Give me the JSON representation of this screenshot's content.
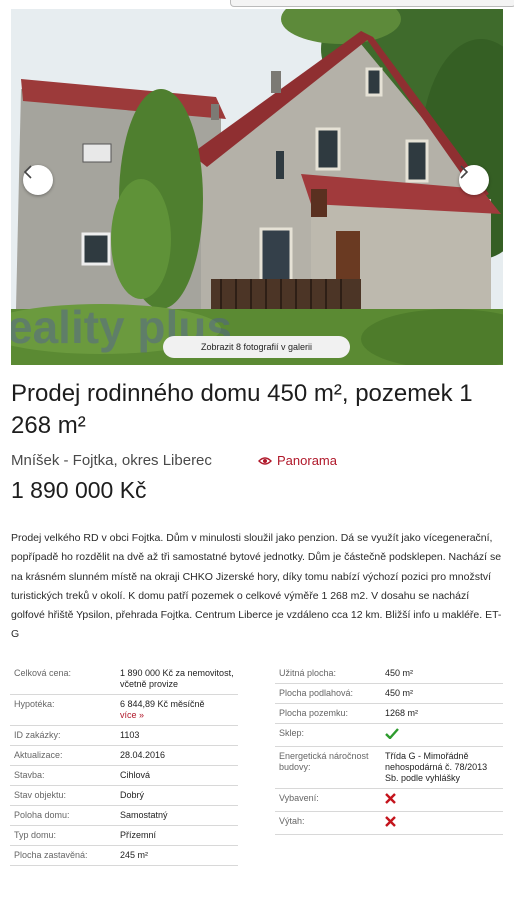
{
  "gallery": {
    "watermark": "eality plus",
    "all_photos_label": "Zobrazit 8 fotografií v galerii",
    "prev_icon": "chevron-left-icon",
    "next_icon": "chevron-right-icon"
  },
  "listing": {
    "title": "Prodej rodinného domu 450 m², pozemek 1 268 m²",
    "location": "Mníšek - Fojtka, okres Liberec",
    "panorama_label": "Panorama",
    "price": "1 890 000 Kč",
    "description": "Prodej velkého RD v obci Fojtka. Dům v minulosti sloužil jako penzion. Dá se využít jako vícegenerační, popřípadě ho rozdělit na dvě až tři samostatné bytové jednotky. Dům je částečně podsklepen. Nachází se na krásném slunném místě na okraji CHKO Jizerské hory, díky tomu nabízí výchozí pozici pro množství turistických treků v okolí. K domu patří pozemek o celkové výměře 1 268 m2. V dosahu se nachází golfové hřiště Ypsilon, přehrada Fojtka. Centrum Liberce je vzdáleno cca 12 km. Bližší info u makléře. ET-G"
  },
  "params_left": [
    {
      "label": "Celková cena:",
      "value": "1 890 000 Kč za nemovitost, včetně provize"
    },
    {
      "label": "Hypotéka:",
      "value": "6 844,89 Kč měsíčně",
      "link": "více »"
    },
    {
      "label": "ID zakázky:",
      "value": "1103"
    },
    {
      "label": "Aktualizace:",
      "value": "28.04.2016"
    },
    {
      "label": "Stavba:",
      "value": "Cihlová"
    },
    {
      "label": "Stav objektu:",
      "value": "Dobrý"
    },
    {
      "label": "Poloha domu:",
      "value": "Samostatný"
    },
    {
      "label": "Typ domu:",
      "value": "Přízemní"
    },
    {
      "label": "Plocha zastavěná:",
      "value": "245 m²"
    }
  ],
  "params_right": [
    {
      "label": "Užitná plocha:",
      "value": "450 m²"
    },
    {
      "label": "Plocha podlahová:",
      "value": "450 m²"
    },
    {
      "label": "Plocha pozemku:",
      "value": "1268 m²"
    },
    {
      "label": "Sklep:",
      "icon": "check-icon"
    },
    {
      "label": "Energetická náročnost budovy:",
      "value": "Třída G - Mimořádně nehospodárná č. 78/2013 Sb. podle vyhlášky"
    },
    {
      "label": "Vybavení:",
      "icon": "cross-icon"
    },
    {
      "label": "Výtah:",
      "icon": "cross-icon"
    }
  ],
  "colors": {
    "accent": "#b0182a",
    "check": "#2e9b2e",
    "cross": "#c4141c"
  }
}
